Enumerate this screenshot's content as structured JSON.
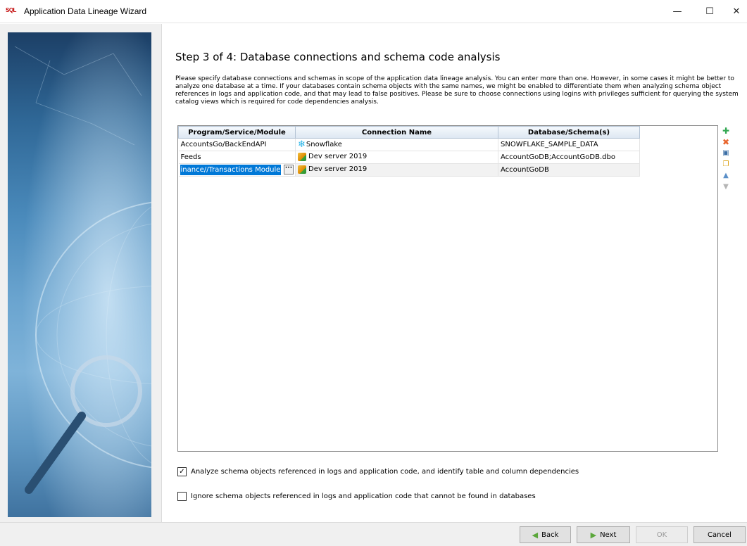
{
  "window": {
    "app_icon_text": "SQL",
    "title": "Application Data Lineage Wizard",
    "minimize_glyph": "—",
    "maximize_glyph": "☐",
    "close_glyph": "✕"
  },
  "step": {
    "title": "Step 3 of 4:  Database connections and schema code analysis",
    "description": "Please specify database connections and schemas in scope of the application data lineage analysis. You can enter more than one. However, in some cases it might be better to analyze one database at a time. If your databases contain schema objects with the same names, we might be enabled to differentiate them when analyzing schema object references in logs and application code, and that may lead to false positives. Please be sure to choose connections using logins with privileges sufficient for querying the system catalog views which is required for code dependencies analysis."
  },
  "grid": {
    "columns": [
      "Program/Service/Module",
      "Connection Name",
      "Database/Schema(s)"
    ],
    "rows": [
      {
        "module": "AccountsGo/BackEndAPI",
        "connection": "Snowflake",
        "connection_icon": "snowflake-icon",
        "schema": "SNOWFLAKE_SAMPLE_DATA"
      },
      {
        "module": "Feeds",
        "connection": "Dev server 2019",
        "connection_icon": "sql-server-icon",
        "schema": "AccountGoDB;AccountGoDB.dbo"
      },
      {
        "module": "inance//Transactions Module",
        "connection": "Dev server 2019",
        "connection_icon": "sql-server-icon",
        "schema": "AccountGoDB",
        "editing": true
      }
    ],
    "ellipsis_label": "···"
  },
  "toolbar": {
    "icons": [
      "add-icon",
      "delete-icon",
      "edit-icon",
      "copy-icon",
      "move-up-icon",
      "move-down-icon"
    ]
  },
  "options": {
    "analyze_label": "Analyze schema objects referenced in logs and application code, and identify table and column dependencies",
    "analyze_checked": true,
    "ignore_label": "Ignore schema objects referenced in logs and application code that cannot be found in databases",
    "ignore_checked": false
  },
  "footer": {
    "back_label": "Back",
    "next_label": "Next",
    "ok_label": "OK",
    "cancel_label": "Cancel"
  }
}
